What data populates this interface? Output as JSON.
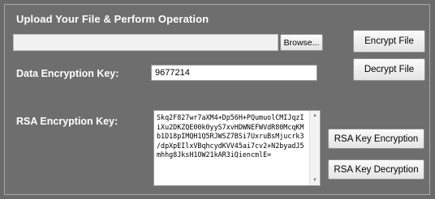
{
  "header": {
    "title": "Upload Your File & Perform Operation"
  },
  "file": {
    "path_value": "",
    "browse_label": "Browse...",
    "encrypt_label": "Encrypt File",
    "decrypt_label": "Decrypt File"
  },
  "data_key": {
    "label": "Data Encryption Key:",
    "value": "9677214"
  },
  "rsa_key": {
    "label": "RSA Encryption Key:",
    "value": "Skq2F827wr7aXM4+Dp56H+PQumuolCMIJqzI\niXu2DKZQE00k0yyS7xvHDWNEFWVdR80McqKM\nb1D18pIMQH1Q5RJWSZ7BSi7UxruBsMjucrk3\n/dpXpEIlxVBqhcydKVV45ai7cv2+N2byadJ5\nmhhg8JksH1OW21kAR3iQiencmlE=",
    "encryption_label": "RSA Key Encryption",
    "decryption_label": "RSA Key Decryption"
  },
  "icons": {
    "scroll_up": "scroll-up-arrow-icon",
    "scroll_down": "scroll-down-arrow-icon"
  },
  "colors": {
    "panel_bg": "#6e6e6e",
    "label_text": "#ffffff",
    "button_bg": "#f2f2f2"
  }
}
